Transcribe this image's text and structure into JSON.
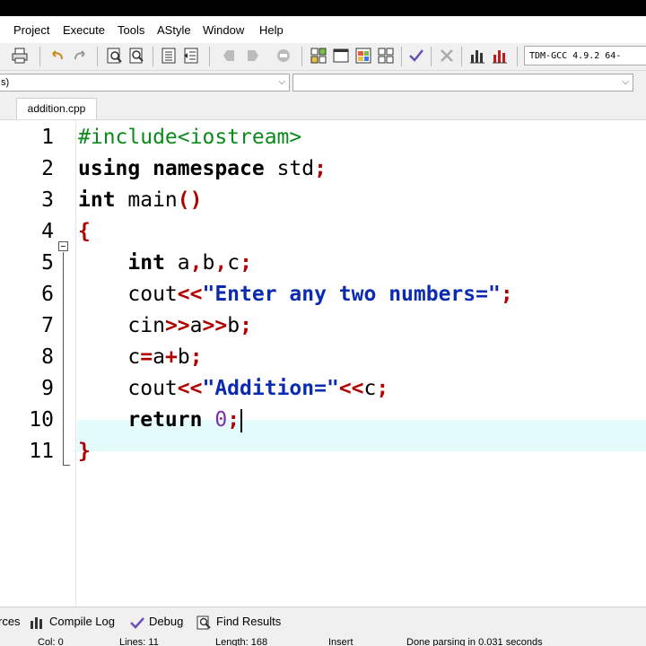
{
  "menu": [
    "Project",
    "Execute",
    "Tools",
    "AStyle",
    "Window",
    "Help"
  ],
  "toolbar": {
    "compiler": "TDM-GCC 4.9.2 64-"
  },
  "combos": {
    "left_text": "s)",
    "right_text": ""
  },
  "tab": {
    "filename": "addition.cpp"
  },
  "editor": {
    "line_numbers": [
      "1",
      "2",
      "3",
      "4",
      "5",
      "6",
      "7",
      "8",
      "9",
      "10",
      "11"
    ],
    "lines": [
      [
        {
          "t": "#include<iostream>",
          "c": "pp"
        }
      ],
      [
        {
          "t": "using namespace",
          "c": "kw"
        },
        {
          "t": " std",
          "c": ""
        },
        {
          "t": ";",
          "c": "sym"
        }
      ],
      [
        {
          "t": "int",
          "c": "kw"
        },
        {
          "t": " main",
          "c": ""
        },
        {
          "t": "()",
          "c": "sym"
        }
      ],
      [
        {
          "t": "{",
          "c": "sym"
        }
      ],
      [
        {
          "t": "    ",
          "c": ""
        },
        {
          "t": "int",
          "c": "kw"
        },
        {
          "t": " a",
          "c": ""
        },
        {
          "t": ",",
          "c": "sym"
        },
        {
          "t": "b",
          "c": ""
        },
        {
          "t": ",",
          "c": "sym"
        },
        {
          "t": "c",
          "c": ""
        },
        {
          "t": ";",
          "c": "sym"
        }
      ],
      [
        {
          "t": "    cout",
          "c": ""
        },
        {
          "t": "<<",
          "c": "sym"
        },
        {
          "t": "\"Enter any two numbers=\"",
          "c": "str"
        },
        {
          "t": ";",
          "c": "sym"
        }
      ],
      [
        {
          "t": "    cin",
          "c": ""
        },
        {
          "t": ">>",
          "c": "sym"
        },
        {
          "t": "a",
          "c": ""
        },
        {
          "t": ">>",
          "c": "sym"
        },
        {
          "t": "b",
          "c": ""
        },
        {
          "t": ";",
          "c": "sym"
        }
      ],
      [
        {
          "t": "    c",
          "c": ""
        },
        {
          "t": "=",
          "c": "sym"
        },
        {
          "t": "a",
          "c": ""
        },
        {
          "t": "+",
          "c": "sym"
        },
        {
          "t": "b",
          "c": ""
        },
        {
          "t": ";",
          "c": "sym"
        }
      ],
      [
        {
          "t": "    cout",
          "c": ""
        },
        {
          "t": "<<",
          "c": "sym"
        },
        {
          "t": "\"Addition=\"",
          "c": "str"
        },
        {
          "t": "<<",
          "c": "sym"
        },
        {
          "t": "c",
          "c": ""
        },
        {
          "t": ";",
          "c": "sym"
        }
      ],
      [
        {
          "t": "    ",
          "c": ""
        },
        {
          "t": "return",
          "c": "kw"
        },
        {
          "t": " ",
          "c": ""
        },
        {
          "t": "0",
          "c": "num"
        },
        {
          "t": ";",
          "c": "sym"
        }
      ],
      [
        {
          "t": "}",
          "c": "sym"
        }
      ]
    ]
  },
  "bottom_tabs": {
    "resources": "rces",
    "compile_log": "Compile Log",
    "debug": "Debug",
    "find_results": "Find Results"
  },
  "status": {
    "col": "Col:   0",
    "lines": "Lines:   11",
    "length": "Length:  168",
    "mode": "Insert",
    "message": "Done parsing in 0.031 seconds"
  }
}
